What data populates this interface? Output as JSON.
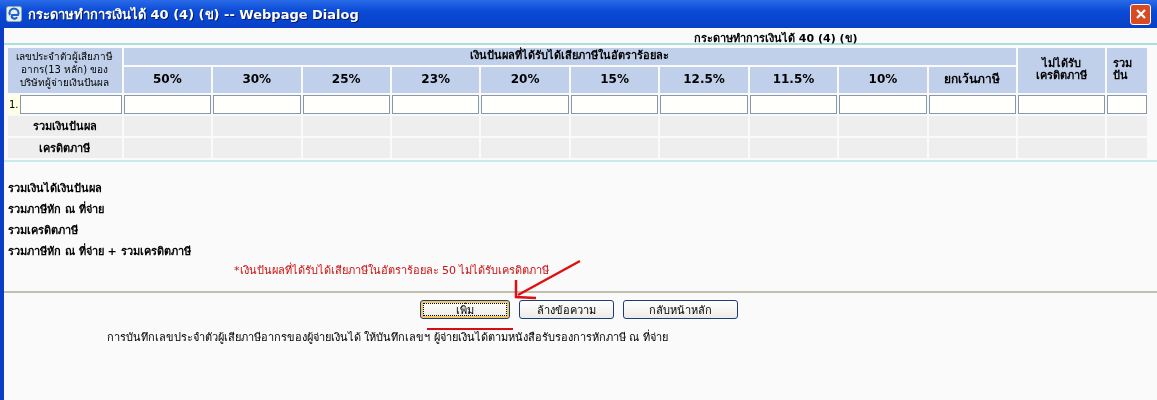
{
  "window": {
    "title": "กระดาษทำการเงินได้ 40 (4) (ข) -- Webpage Dialog"
  },
  "page_title": "กระดาษทำการเงินได้ 40 (4) (ข)",
  "table": {
    "id_column": "เลขประจำตัวผู้เสียภาษีอากร(13 หลัก) ของบริษัทผู้จ่ายเงินปันผล",
    "group_heading": "เงินปันผลที่ได้รับได้เสียภาษีในอัตราร้อยละ",
    "rate_columns": [
      "50%",
      "30%",
      "25%",
      "23%",
      "20%",
      "15%",
      "12.5%",
      "11.5%",
      "10%",
      "ยกเว้นภาษี"
    ],
    "extra_columns": [
      "ไม่ได้รับ เครดิตภาษี",
      "รวม ปัน"
    ],
    "rows": [
      {
        "number": "1."
      }
    ],
    "total_rows": [
      "รวมเงินปันผล",
      "เครดิตภาษี"
    ]
  },
  "summary": [
    "รวมเงินได้เงินปันผล",
    "รวมภาษีหัก ณ ที่จ่าย",
    "รวมเครดิตภาษี",
    "รวมภาษีหัก ณ ที่จ่าย + รวมเครดิตภาษี"
  ],
  "note": "*เงินปันผลที่ได้รับได้เสียภาษีในอัตราร้อยละ 50 ไม่ได้รับเครดิตภาษี",
  "buttons": [
    {
      "label": "เพิ่ม",
      "focused": true
    },
    {
      "label": "ล้างข้อความ",
      "focused": false
    },
    {
      "label": "กลับหน้าหลัก",
      "focused": false
    }
  ],
  "instruction": "การบันทึกเลขประจำตัวผู้เสียภาษีอากรของผู้จ่ายเงินได้ ให้บันทึกเลขฯ ผู้จ่ายเงินได้ตามหนังสือรับรองการหักภาษี ณ ที่จ่าย"
}
